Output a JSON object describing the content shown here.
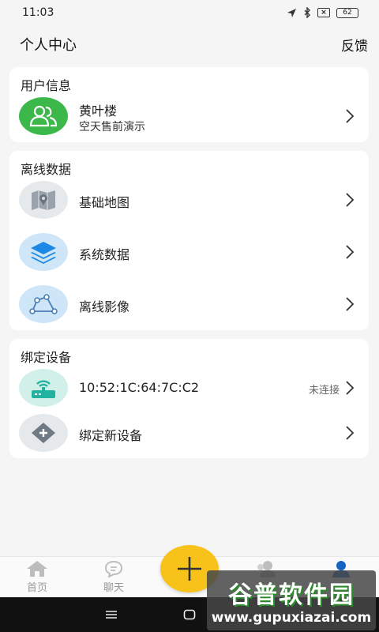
{
  "status_bar": {
    "time": "11:03",
    "battery": "62"
  },
  "header": {
    "title": "个人中心",
    "action": "反馈"
  },
  "user_card": {
    "title": "用户信息",
    "name": "黄叶楼",
    "subtitle": "空天售前演示"
  },
  "offline_card": {
    "title": "离线数据",
    "items": [
      {
        "label": "基础地图",
        "icon": "map-icon"
      },
      {
        "label": "系统数据",
        "icon": "layers-icon"
      },
      {
        "label": "离线影像",
        "icon": "polyline-icon"
      }
    ]
  },
  "device_card": {
    "title": "绑定设备",
    "device": {
      "label": "10:52:1C:64:7C:C2",
      "status": "未连接",
      "icon": "router-icon"
    },
    "add": {
      "label": "绑定新设备",
      "icon": "plus-icon"
    }
  },
  "bottom_nav": {
    "items": [
      {
        "label": "首页",
        "icon": "home-icon"
      },
      {
        "label": "聊天",
        "icon": "chat-icon"
      }
    ],
    "fab_icon": "plus-icon"
  },
  "watermark": {
    "title": "谷普软件园",
    "url": "www.gupuxiazai.com"
  },
  "colors": {
    "accent_yellow": "#f7c21a",
    "green": "#3cb84a",
    "light_blue": "#cfe6f8",
    "teal_light": "#d2f0ea",
    "grey_light": "#e6e9ec"
  }
}
